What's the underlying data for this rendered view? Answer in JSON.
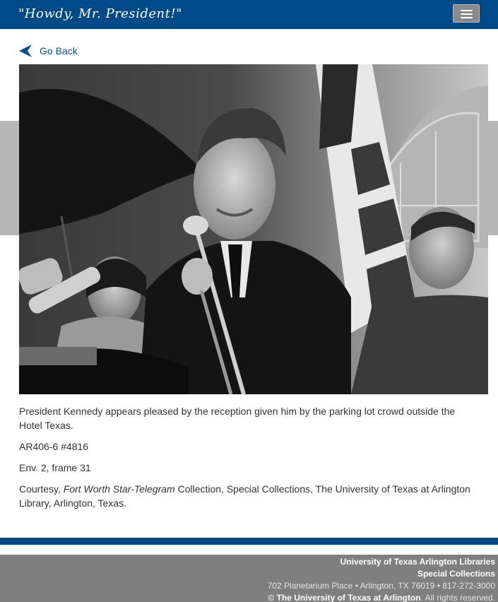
{
  "header": {
    "site_title": "\"Howdy, Mr. President!\"",
    "menu_icon": "hamburger-menu-icon"
  },
  "nav": {
    "back_label": "Go Back",
    "back_icon": "back-arrow-icon"
  },
  "caption": {
    "description": "President Kennedy appears pleased by the reception given him by the parking lot crowd outside the Hotel Texas.",
    "archive_number": "AR406-6 #4816",
    "envelope_frame": "Env. 2, frame 31",
    "courtesy_prefix": "Courtesy, ",
    "courtesy_collection": "Fort Worth Star-Telegram",
    "courtesy_suffix": " Collection, Special Collections, The University of Texas at Arlington Library, Arlington, Texas."
  },
  "footer": {
    "library_name": "University of Texas Arlington Libraries",
    "department": "Special Collections",
    "address": "702 Planetarium Place • Arlington, TX 76019 • 817-272-3000",
    "copyright_symbol": "© ",
    "university_link": "The University of Texas at Arlington",
    "rights": ". All rights reserved."
  },
  "colors": {
    "brand_blue": "#004b87",
    "link_blue": "#0a4f8a",
    "footer_gray": "#7f7f7f",
    "menu_button_gray": "#8a8a8a"
  }
}
